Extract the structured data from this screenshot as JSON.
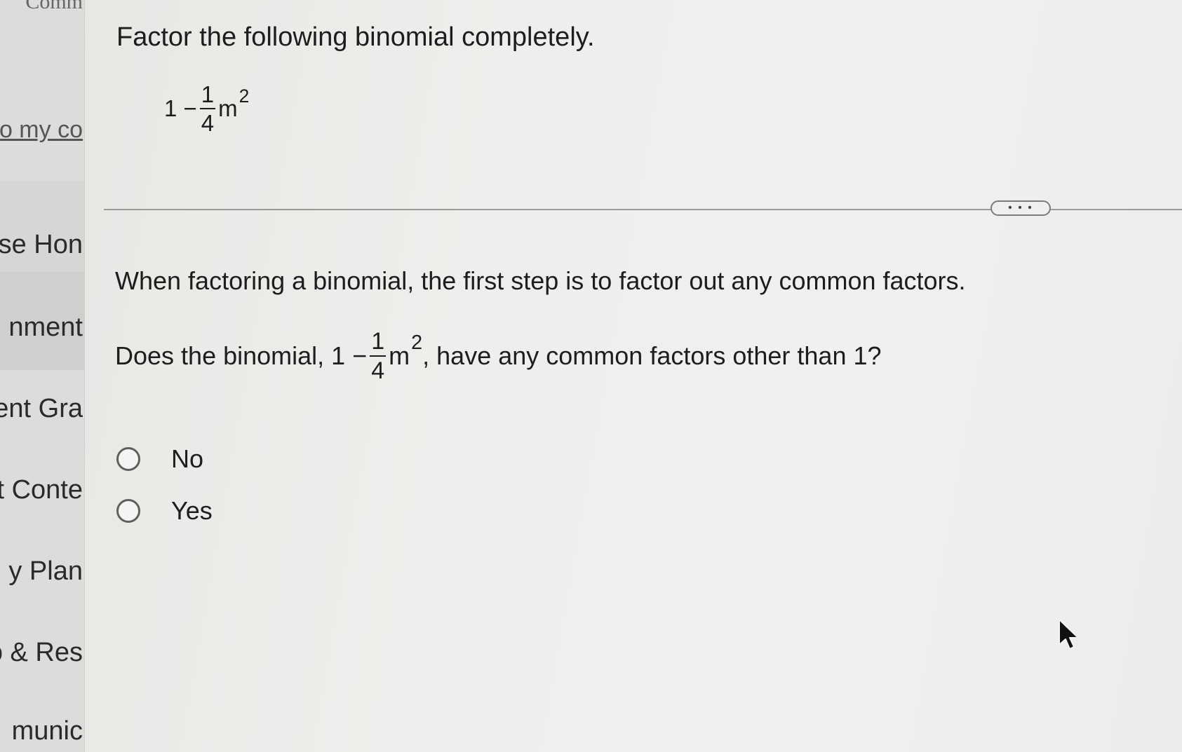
{
  "sidebar": {
    "items": [
      {
        "label": "Comm"
      },
      {
        "label": "o my co"
      },
      {
        "label": "se Hon"
      },
      {
        "label": "nment"
      },
      {
        "label": "ent Gra"
      },
      {
        "label": "t Conte"
      },
      {
        "label": "y Plan"
      },
      {
        "label": "o & Res"
      },
      {
        "label": "munic"
      }
    ]
  },
  "problem": {
    "instruction": "Factor the following binomial completely.",
    "expression": {
      "lead": "1 −",
      "numerator": "1",
      "denominator": "4",
      "variable": "m",
      "exponent": "2"
    }
  },
  "more_button": {
    "label": "• • •"
  },
  "hint": {
    "text": "When factoring a binomial, the first step is to factor out any common factors."
  },
  "question": {
    "before": "Does the binomial, 1 −",
    "numerator": "1",
    "denominator": "4",
    "variable": "m",
    "exponent": "2",
    "after": ", have any common factors other than 1?"
  },
  "options": [
    {
      "label": "No"
    },
    {
      "label": "Yes"
    }
  ]
}
